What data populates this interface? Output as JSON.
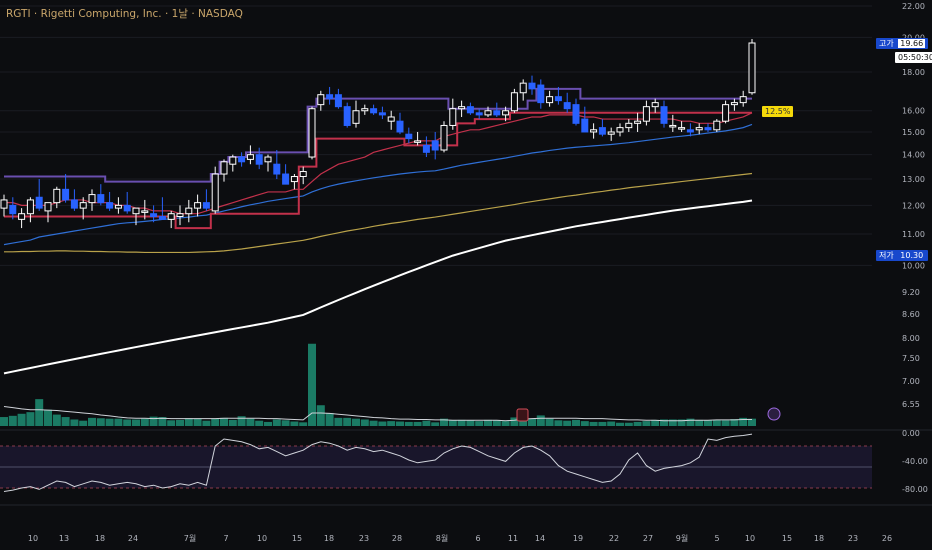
{
  "header": {
    "symbol": "RGTI",
    "sep1": " · ",
    "name": "Rigetti Computing, Inc.",
    "sep2": " · ",
    "interval": "1날",
    "sep3": " · ",
    "exchange": "NASDAQ"
  },
  "tags": {
    "high_label": "고가",
    "high_value": "19.66",
    "countdown": "05:50:30",
    "low_label": "저가",
    "low_value": "10.30",
    "pct_change": "12.5%"
  },
  "colors": {
    "background": "#0c0d10",
    "candle_up": "#ffffff",
    "candle_down": "#2962ff",
    "volume_bar": "#1e8f74",
    "ma_blue": "#2f6fd6",
    "ma_red": "#c2314b",
    "ma_yellow": "#b9a24a",
    "ma_white": "#ffffff",
    "step_line": "#6a4fb0",
    "rsi_line": "#d1d4dc",
    "tag_yellow": "#f5d90a"
  },
  "chart_data": {
    "type": "candlestick",
    "scale": "log",
    "price_axis": {
      "ylim": [
        9.0,
        22.0
      ],
      "tick_labels": [
        "22.00",
        "20.00",
        "18.00",
        "16.00",
        "15.00",
        "14.00",
        "13.00",
        "12.00",
        "11.00",
        "10.00",
        "9.20",
        "8.60",
        "8.00",
        "7.50",
        "7.00",
        "6.55"
      ]
    },
    "rsi_axis": {
      "ylim": [
        -100,
        0
      ],
      "tick_labels": [
        "0.00",
        "-40.00",
        "-80.00"
      ],
      "bands": [
        -20,
        -80
      ]
    },
    "x_tick_labels": [
      "10",
      "13",
      "18",
      "24",
      "7월",
      "7",
      "10",
      "15",
      "18",
      "23",
      "28",
      "8월",
      "6",
      "11",
      "14",
      "19",
      "22",
      "27",
      "9월",
      "5",
      "10",
      "15",
      "18",
      "23",
      "26"
    ],
    "candles": [
      {
        "o": 11.9,
        "h": 12.4,
        "l": 11.6,
        "c": 12.2
      },
      {
        "o": 12.0,
        "h": 12.3,
        "l": 11.5,
        "c": 11.7
      },
      {
        "o": 11.5,
        "h": 11.9,
        "l": 11.2,
        "c": 11.7
      },
      {
        "o": 11.7,
        "h": 12.3,
        "l": 11.4,
        "c": 12.2
      },
      {
        "o": 12.3,
        "h": 13.0,
        "l": 11.8,
        "c": 11.9
      },
      {
        "o": 11.8,
        "h": 12.1,
        "l": 11.4,
        "c": 12.1
      },
      {
        "o": 12.1,
        "h": 12.7,
        "l": 11.9,
        "c": 12.6
      },
      {
        "o": 12.6,
        "h": 13.2,
        "l": 12.1,
        "c": 12.2
      },
      {
        "o": 12.2,
        "h": 12.6,
        "l": 11.8,
        "c": 11.9
      },
      {
        "o": 11.9,
        "h": 12.3,
        "l": 11.5,
        "c": 12.1
      },
      {
        "o": 12.1,
        "h": 12.6,
        "l": 11.8,
        "c": 12.4
      },
      {
        "o": 12.4,
        "h": 12.8,
        "l": 12.0,
        "c": 12.1
      },
      {
        "o": 12.1,
        "h": 12.5,
        "l": 11.8,
        "c": 11.9
      },
      {
        "o": 11.9,
        "h": 12.3,
        "l": 11.7,
        "c": 12.0
      },
      {
        "o": 12.0,
        "h": 12.5,
        "l": 11.7,
        "c": 11.8
      },
      {
        "o": 11.7,
        "h": 11.9,
        "l": 11.3,
        "c": 11.9
      },
      {
        "o": 11.8,
        "h": 12.2,
        "l": 11.5,
        "c": 11.8
      },
      {
        "o": 11.7,
        "h": 12.0,
        "l": 11.4,
        "c": 11.6
      },
      {
        "o": 11.6,
        "h": 12.3,
        "l": 11.5,
        "c": 11.5
      },
      {
        "o": 11.5,
        "h": 11.8,
        "l": 11.2,
        "c": 11.7
      },
      {
        "o": 11.6,
        "h": 12.0,
        "l": 11.3,
        "c": 11.7
      },
      {
        "o": 11.7,
        "h": 12.2,
        "l": 11.4,
        "c": 11.9
      },
      {
        "o": 11.9,
        "h": 12.4,
        "l": 11.6,
        "c": 12.1
      },
      {
        "o": 12.1,
        "h": 12.6,
        "l": 11.8,
        "c": 11.9
      },
      {
        "o": 11.8,
        "h": 13.5,
        "l": 11.7,
        "c": 13.2
      },
      {
        "o": 13.2,
        "h": 13.8,
        "l": 12.9,
        "c": 13.7
      },
      {
        "o": 13.6,
        "h": 14.0,
        "l": 13.3,
        "c": 13.9
      },
      {
        "o": 13.9,
        "h": 14.1,
        "l": 13.5,
        "c": 13.7
      },
      {
        "o": 13.8,
        "h": 14.4,
        "l": 13.6,
        "c": 14.0
      },
      {
        "o": 14.0,
        "h": 14.3,
        "l": 13.4,
        "c": 13.6
      },
      {
        "o": 13.7,
        "h": 14.0,
        "l": 13.3,
        "c": 13.9
      },
      {
        "o": 13.6,
        "h": 14.2,
        "l": 13.0,
        "c": 13.2
      },
      {
        "o": 13.2,
        "h": 13.6,
        "l": 12.8,
        "c": 12.8
      },
      {
        "o": 12.9,
        "h": 13.2,
        "l": 12.6,
        "c": 13.1
      },
      {
        "o": 13.1,
        "h": 13.5,
        "l": 12.8,
        "c": 13.3
      },
      {
        "o": 13.9,
        "h": 16.2,
        "l": 13.8,
        "c": 16.1
      },
      {
        "o": 16.3,
        "h": 17.0,
        "l": 16.0,
        "c": 16.8
      },
      {
        "o": 16.8,
        "h": 17.2,
        "l": 16.3,
        "c": 16.6
      },
      {
        "o": 16.8,
        "h": 17.1,
        "l": 16.1,
        "c": 16.2
      },
      {
        "o": 16.2,
        "h": 16.4,
        "l": 15.2,
        "c": 15.3
      },
      {
        "o": 15.4,
        "h": 16.5,
        "l": 15.2,
        "c": 16.0
      },
      {
        "o": 16.0,
        "h": 16.3,
        "l": 15.8,
        "c": 16.1
      },
      {
        "o": 16.1,
        "h": 16.3,
        "l": 15.8,
        "c": 15.9
      },
      {
        "o": 15.9,
        "h": 16.2,
        "l": 15.6,
        "c": 15.8
      },
      {
        "o": 15.5,
        "h": 16.0,
        "l": 15.1,
        "c": 15.7
      },
      {
        "o": 15.5,
        "h": 15.9,
        "l": 14.9,
        "c": 15.0
      },
      {
        "o": 14.9,
        "h": 15.2,
        "l": 14.5,
        "c": 14.7
      },
      {
        "o": 14.6,
        "h": 15.0,
        "l": 14.4,
        "c": 14.6
      },
      {
        "o": 14.4,
        "h": 14.8,
        "l": 13.9,
        "c": 14.1
      },
      {
        "o": 14.6,
        "h": 15.0,
        "l": 13.8,
        "c": 14.2
      },
      {
        "o": 14.2,
        "h": 15.5,
        "l": 14.1,
        "c": 15.3
      },
      {
        "o": 15.3,
        "h": 16.6,
        "l": 15.1,
        "c": 16.1
      },
      {
        "o": 16.1,
        "h": 16.5,
        "l": 15.7,
        "c": 16.2
      },
      {
        "o": 16.2,
        "h": 16.4,
        "l": 15.8,
        "c": 15.9
      },
      {
        "o": 15.9,
        "h": 16.1,
        "l": 15.6,
        "c": 15.8
      },
      {
        "o": 15.8,
        "h": 16.2,
        "l": 15.7,
        "c": 16.0
      },
      {
        "o": 16.0,
        "h": 16.4,
        "l": 15.7,
        "c": 15.8
      },
      {
        "o": 15.8,
        "h": 16.2,
        "l": 15.5,
        "c": 16.0
      },
      {
        "o": 16.0,
        "h": 17.1,
        "l": 15.9,
        "c": 16.9
      },
      {
        "o": 16.9,
        "h": 17.6,
        "l": 16.5,
        "c": 17.4
      },
      {
        "o": 17.4,
        "h": 17.8,
        "l": 16.8,
        "c": 17.1
      },
      {
        "o": 17.3,
        "h": 17.6,
        "l": 16.1,
        "c": 16.4
      },
      {
        "o": 16.4,
        "h": 17.0,
        "l": 16.2,
        "c": 16.7
      },
      {
        "o": 16.7,
        "h": 17.2,
        "l": 16.3,
        "c": 16.5
      },
      {
        "o": 16.4,
        "h": 16.9,
        "l": 15.9,
        "c": 16.1
      },
      {
        "o": 16.3,
        "h": 16.6,
        "l": 15.3,
        "c": 15.4
      },
      {
        "o": 15.6,
        "h": 16.2,
        "l": 15.0,
        "c": 15.0
      },
      {
        "o": 15.0,
        "h": 15.4,
        "l": 14.7,
        "c": 15.1
      },
      {
        "o": 15.2,
        "h": 15.6,
        "l": 14.8,
        "c": 14.9
      },
      {
        "o": 14.9,
        "h": 15.2,
        "l": 14.6,
        "c": 15.0
      },
      {
        "o": 15.0,
        "h": 15.4,
        "l": 14.8,
        "c": 15.2
      },
      {
        "o": 15.2,
        "h": 15.6,
        "l": 15.0,
        "c": 15.4
      },
      {
        "o": 15.4,
        "h": 15.9,
        "l": 15.0,
        "c": 15.5
      },
      {
        "o": 15.5,
        "h": 16.5,
        "l": 15.3,
        "c": 16.2
      },
      {
        "o": 16.2,
        "h": 16.6,
        "l": 15.9,
        "c": 16.4
      },
      {
        "o": 16.2,
        "h": 16.5,
        "l": 15.2,
        "c": 15.4
      },
      {
        "o": 15.3,
        "h": 15.8,
        "l": 15.0,
        "c": 15.3
      },
      {
        "o": 15.2,
        "h": 15.5,
        "l": 15.0,
        "c": 15.2
      },
      {
        "o": 15.1,
        "h": 15.4,
        "l": 14.8,
        "c": 15.0
      },
      {
        "o": 15.1,
        "h": 15.4,
        "l": 14.9,
        "c": 15.2
      },
      {
        "o": 15.2,
        "h": 15.4,
        "l": 15.0,
        "c": 15.1
      },
      {
        "o": 15.1,
        "h": 15.6,
        "l": 15.0,
        "c": 15.5
      },
      {
        "o": 15.5,
        "h": 16.5,
        "l": 15.4,
        "c": 16.3
      },
      {
        "o": 16.3,
        "h": 16.6,
        "l": 16.0,
        "c": 16.4
      },
      {
        "o": 16.4,
        "h": 17.0,
        "l": 16.2,
        "c": 16.7
      },
      {
        "o": 16.9,
        "h": 19.9,
        "l": 16.8,
        "c": 19.66
      }
    ],
    "volume": [
      6.72,
      6.75,
      6.8,
      6.84,
      7.16,
      6.9,
      6.78,
      6.72,
      6.66,
      6.63,
      6.7,
      6.69,
      6.68,
      6.68,
      6.66,
      6.66,
      6.68,
      6.73,
      6.72,
      6.64,
      6.65,
      6.69,
      6.68,
      6.63,
      6.68,
      6.7,
      6.65,
      6.74,
      6.68,
      6.63,
      6.6,
      6.66,
      6.64,
      6.61,
      6.59,
      8.52,
      7.01,
      6.82,
      6.7,
      6.7,
      6.68,
      6.66,
      6.63,
      6.61,
      6.62,
      6.61,
      6.6,
      6.6,
      6.63,
      6.59,
      6.68,
      6.64,
      6.65,
      6.64,
      6.62,
      6.65,
      6.64,
      6.62,
      6.71,
      6.91,
      6.68,
      6.76,
      6.68,
      6.64,
      6.63,
      6.65,
      6.62,
      6.6,
      6.6,
      6.61,
      6.58,
      6.58,
      6.6,
      6.62,
      6.65,
      6.66,
      6.66,
      6.66,
      6.68,
      6.65,
      6.64,
      6.65,
      6.64,
      6.67,
      6.7,
      6.68
    ],
    "volume_ma": [
      6.98,
      6.95,
      6.92,
      6.9,
      6.9,
      6.89,
      6.88,
      6.86,
      6.84,
      6.82,
      6.8,
      6.77,
      6.75,
      6.72,
      6.7,
      6.69,
      6.69,
      6.68,
      6.69,
      6.68,
      6.68,
      6.68,
      6.68,
      6.68,
      6.68,
      6.69,
      6.69,
      6.69,
      6.69,
      6.69,
      6.68,
      6.68,
      6.67,
      6.66,
      6.65,
      6.82,
      6.82,
      6.81,
      6.79,
      6.77,
      6.75,
      6.73,
      6.71,
      6.7,
      6.68,
      6.67,
      6.67,
      6.66,
      6.66,
      6.65,
      6.65,
      6.64,
      6.64,
      6.64,
      6.64,
      6.64,
      6.64,
      6.63,
      6.64,
      6.67,
      6.68,
      6.69,
      6.69,
      6.69,
      6.69,
      6.69,
      6.68,
      6.68,
      6.68,
      6.67,
      6.66,
      6.65,
      6.65,
      6.64,
      6.64,
      6.63,
      6.63,
      6.63,
      6.64,
      6.64,
      6.64,
      6.65,
      6.65,
      6.65,
      6.66,
      6.66
    ],
    "ma_red": [
      12.1,
      12.1,
      12.0,
      12.0,
      12.0,
      12.0,
      12.1,
      12.2,
      12.2,
      12.2,
      12.1,
      12.1,
      12.1,
      12.0,
      12.0,
      11.9,
      11.9,
      11.8,
      11.8,
      11.8,
      11.7,
      11.7,
      11.7,
      11.8,
      11.9,
      12.0,
      12.1,
      12.2,
      12.3,
      12.4,
      12.5,
      12.5,
      12.5,
      12.6,
      12.6,
      12.9,
      13.2,
      13.4,
      13.6,
      13.7,
      13.8,
      13.9,
      14.1,
      14.2,
      14.3,
      14.4,
      14.5,
      14.6,
      14.6,
      14.6,
      14.8,
      14.9,
      15.0,
      15.1,
      15.1,
      15.2,
      15.3,
      15.4,
      15.5,
      15.6,
      15.7,
      15.7,
      15.8,
      15.8,
      15.8,
      15.8,
      15.7,
      15.7,
      15.6,
      15.6,
      15.6,
      15.6,
      15.6,
      15.6,
      15.6,
      15.6,
      15.6,
      15.5,
      15.5,
      15.4,
      15.4,
      15.4,
      15.5,
      15.6,
      15.7,
      15.9
    ],
    "ma_blue": [
      10.65,
      10.7,
      10.75,
      10.8,
      10.9,
      10.95,
      11.0,
      11.05,
      11.1,
      11.15,
      11.2,
      11.25,
      11.3,
      11.35,
      11.38,
      11.4,
      11.43,
      11.46,
      11.5,
      11.52,
      11.55,
      11.58,
      11.62,
      11.65,
      11.72,
      11.8,
      11.87,
      11.95,
      12.02,
      12.08,
      12.15,
      12.2,
      12.25,
      12.3,
      12.35,
      12.5,
      12.62,
      12.72,
      12.8,
      12.87,
      12.93,
      12.99,
      13.05,
      13.1,
      13.15,
      13.2,
      13.24,
      13.28,
      13.31,
      13.33,
      13.4,
      13.48,
      13.56,
      13.62,
      13.68,
      13.74,
      13.8,
      13.86,
      13.93,
      14.0,
      14.07,
      14.12,
      14.18,
      14.23,
      14.28,
      14.32,
      14.35,
      14.38,
      14.41,
      14.44,
      14.48,
      14.52,
      14.57,
      14.62,
      14.67,
      14.72,
      14.77,
      14.81,
      14.85,
      14.9,
      14.95,
      15.0,
      15.05,
      15.12,
      15.2,
      15.35
    ],
    "ma_yellow": [
      10.42,
      10.42,
      10.43,
      10.43,
      10.44,
      10.44,
      10.45,
      10.45,
      10.44,
      10.44,
      10.43,
      10.43,
      10.42,
      10.42,
      10.41,
      10.41,
      10.4,
      10.4,
      10.4,
      10.4,
      10.4,
      10.4,
      10.41,
      10.42,
      10.43,
      10.45,
      10.48,
      10.51,
      10.55,
      10.59,
      10.63,
      10.67,
      10.71,
      10.75,
      10.79,
      10.85,
      10.92,
      10.98,
      11.04,
      11.1,
      11.15,
      11.2,
      11.26,
      11.31,
      11.36,
      11.4,
      11.45,
      11.5,
      11.54,
      11.58,
      11.63,
      11.68,
      11.73,
      11.78,
      11.83,
      11.88,
      11.93,
      11.98,
      12.03,
      12.09,
      12.14,
      12.19,
      12.24,
      12.29,
      12.34,
      12.38,
      12.43,
      12.48,
      12.52,
      12.57,
      12.61,
      12.66,
      12.7,
      12.74,
      12.78,
      12.82,
      12.86,
      12.9,
      12.94,
      12.98,
      13.02,
      13.06,
      13.1,
      13.14,
      13.18,
      13.22
    ],
    "ma_white": [
      7.2,
      7.24,
      7.28,
      7.32,
      7.36,
      7.4,
      7.44,
      7.48,
      7.52,
      7.56,
      7.6,
      7.64,
      7.68,
      7.72,
      7.76,
      7.8,
      7.84,
      7.88,
      7.92,
      7.96,
      8.0,
      8.04,
      8.08,
      8.12,
      8.16,
      8.2,
      8.24,
      8.28,
      8.32,
      8.36,
      8.4,
      8.45,
      8.5,
      8.55,
      8.6,
      8.7,
      8.8,
      8.9,
      9.0,
      9.1,
      9.2,
      9.3,
      9.4,
      9.5,
      9.6,
      9.7,
      9.8,
      9.9,
      10.0,
      10.1,
      10.2,
      10.3,
      10.38,
      10.46,
      10.54,
      10.62,
      10.7,
      10.78,
      10.84,
      10.9,
      10.96,
      11.02,
      11.08,
      11.14,
      11.2,
      11.26,
      11.31,
      11.36,
      11.41,
      11.46,
      11.51,
      11.56,
      11.61,
      11.66,
      11.71,
      11.76,
      11.81,
      11.85,
      11.89,
      11.93,
      11.97,
      12.01,
      12.05,
      12.09,
      12.13,
      12.18
    ],
    "step_upper": [
      13.1,
      13.1,
      13.1,
      13.1,
      13.1,
      13.1,
      13.1,
      13.1,
      13.1,
      13.1,
      13.1,
      13.1,
      12.9,
      12.9,
      12.9,
      12.9,
      12.9,
      12.9,
      12.9,
      12.9,
      12.9,
      12.9,
      12.9,
      12.9,
      13.2,
      13.7,
      13.9,
      13.9,
      14.1,
      14.1,
      14.1,
      14.1,
      14.1,
      14.1,
      14.1,
      16.2,
      16.6,
      16.6,
      16.6,
      16.6,
      16.6,
      16.6,
      16.6,
      16.6,
      16.6,
      16.6,
      16.6,
      16.6,
      16.6,
      16.6,
      16.6,
      16.1,
      16.1,
      16.1,
      16.1,
      16.1,
      16.1,
      16.1,
      16.1,
      16.1,
      16.5,
      17.1,
      17.1,
      17.1,
      17.1,
      17.1,
      16.6,
      16.6,
      16.6,
      16.6,
      16.6,
      16.6,
      16.6,
      16.6,
      16.6,
      16.6,
      16.6,
      16.6,
      16.6,
      16.6,
      16.6,
      16.6,
      16.6,
      16.6,
      16.6,
      16.6
    ],
    "step_lower": [
      11.6,
      11.6,
      11.6,
      11.6,
      11.6,
      11.6,
      11.6,
      11.6,
      11.6,
      11.6,
      11.6,
      11.6,
      11.6,
      11.6,
      11.6,
      11.6,
      11.6,
      11.6,
      11.6,
      11.6,
      11.2,
      11.2,
      11.2,
      11.2,
      11.7,
      11.7,
      11.7,
      11.7,
      11.7,
      11.7,
      11.7,
      11.7,
      11.7,
      11.7,
      13.5,
      13.5,
      14.7,
      14.7,
      14.7,
      14.7,
      14.7,
      14.7,
      14.7,
      14.7,
      14.7,
      14.7,
      14.4,
      14.4,
      14.4,
      14.4,
      14.4,
      14.4,
      15.4,
      15.4,
      15.6,
      15.6,
      15.6,
      15.6,
      15.9,
      15.9,
      15.9,
      15.9,
      15.9,
      15.9,
      15.9,
      15.9,
      15.9,
      15.9,
      15.9,
      15.9,
      15.9,
      15.9,
      15.9,
      15.9,
      15.9,
      15.9,
      15.9,
      15.9,
      15.9,
      15.9,
      15.9,
      15.9,
      15.9,
      15.9,
      15.9,
      15.9
    ],
    "rsi": [
      -85,
      -83,
      -80,
      -78,
      -82,
      -76,
      -70,
      -72,
      -78,
      -74,
      -70,
      -72,
      -76,
      -74,
      -72,
      -74,
      -78,
      -76,
      -80,
      -78,
      -74,
      -76,
      -72,
      -76,
      -20,
      -10,
      -12,
      -14,
      -18,
      -24,
      -22,
      -28,
      -34,
      -30,
      -26,
      -18,
      -14,
      -16,
      -20,
      -26,
      -22,
      -24,
      -28,
      -26,
      -30,
      -34,
      -40,
      -44,
      -42,
      -40,
      -30,
      -24,
      -20,
      -22,
      -28,
      -34,
      -38,
      -42,
      -30,
      -22,
      -20,
      -26,
      -34,
      -48,
      -56,
      -60,
      -64,
      -68,
      -72,
      -70,
      -60,
      -40,
      -30,
      -48,
      -56,
      -52,
      -50,
      -48,
      -44,
      -36,
      -10,
      -12,
      -8,
      -6,
      -5,
      -3
    ],
    "volume_ylim": [
      6.5,
      9.3
    ]
  }
}
